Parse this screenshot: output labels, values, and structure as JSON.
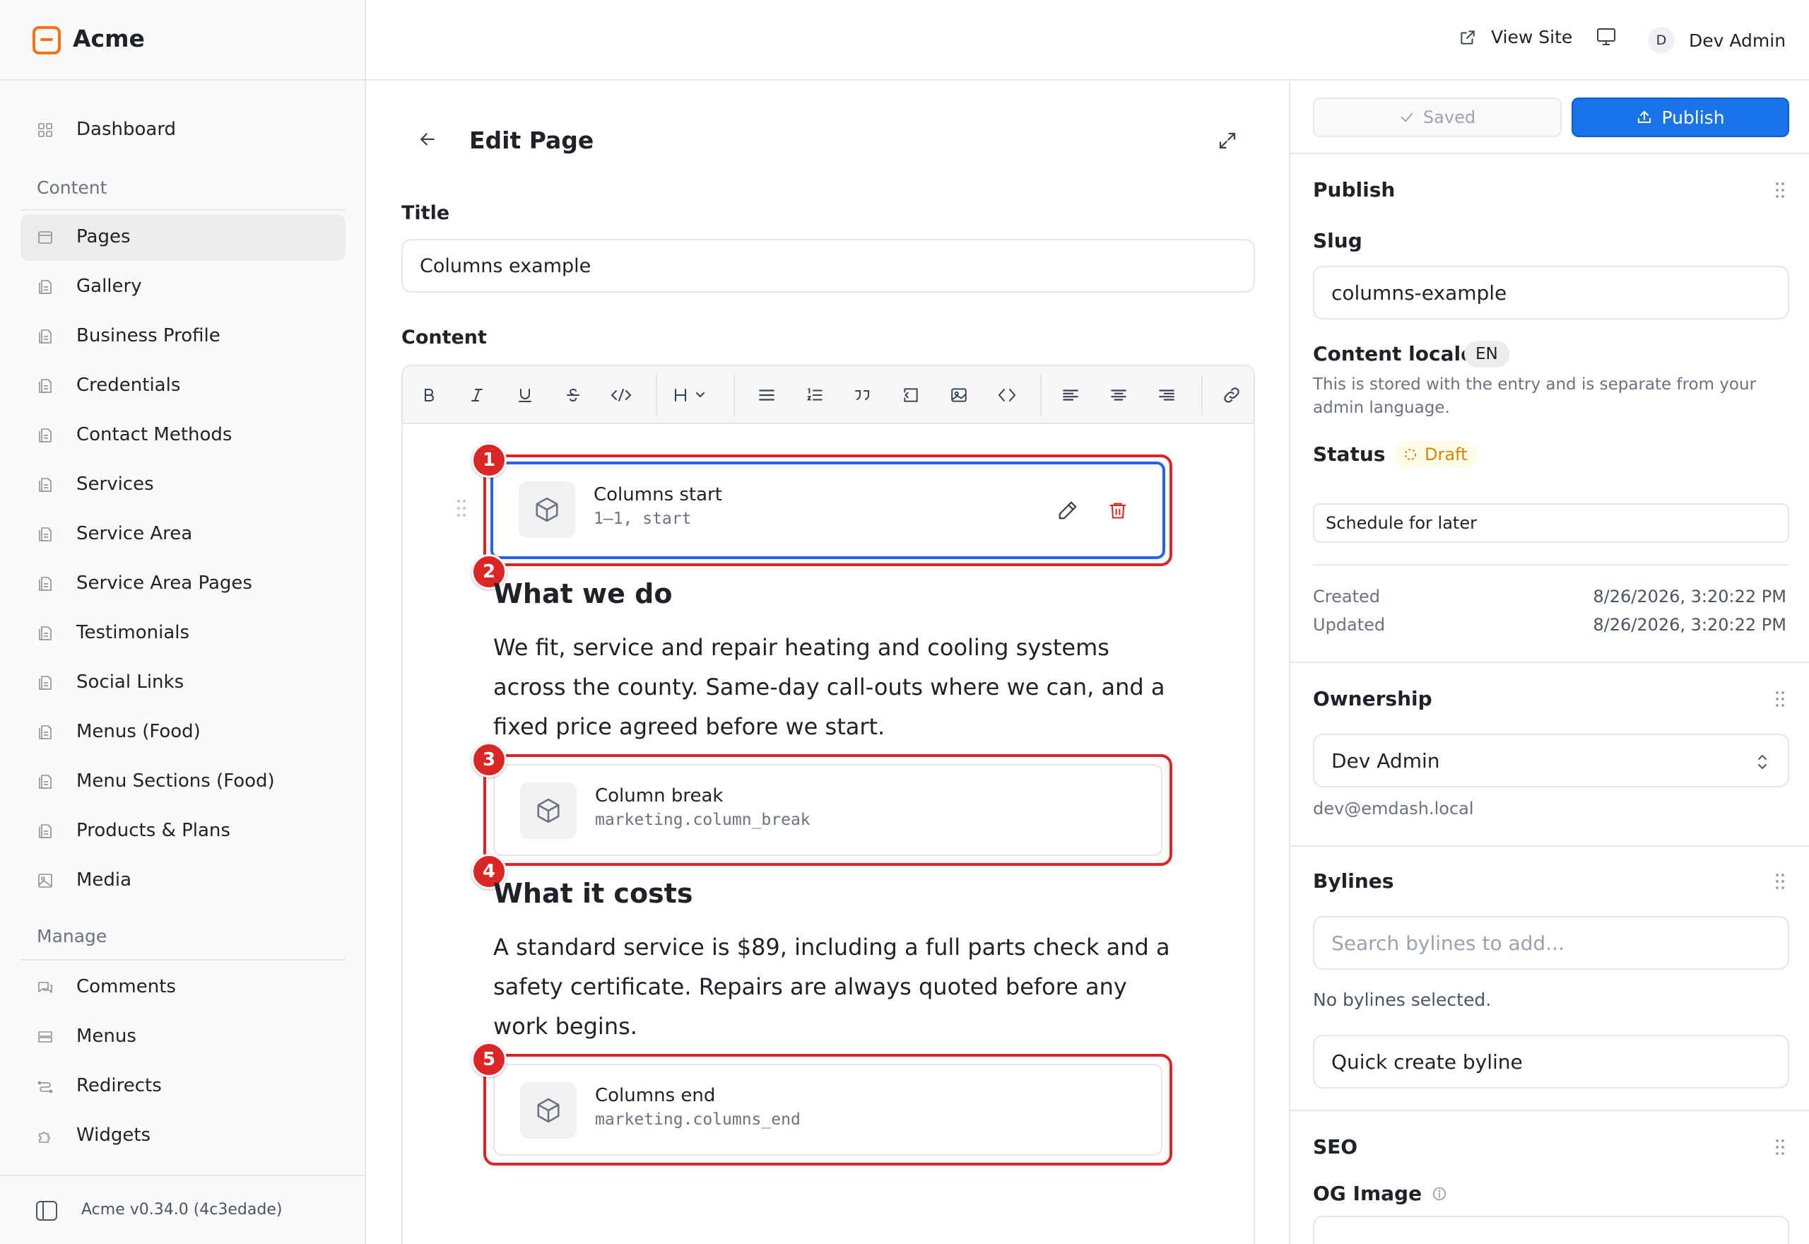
{
  "app": {
    "name": "Acme",
    "version": "Acme v0.34.0 (4c3edade)"
  },
  "topbar": {
    "view_site": "View Site",
    "user_initial": "D",
    "user_name": "Dev Admin"
  },
  "sidebar": {
    "dashboard": "Dashboard",
    "content_heading": "Content",
    "content_items": [
      {
        "label": "Pages",
        "icon": "pages-icon",
        "active": true
      },
      {
        "label": "Gallery",
        "icon": "collection-icon"
      },
      {
        "label": "Business Profile",
        "icon": "collection-icon"
      },
      {
        "label": "Credentials",
        "icon": "collection-icon"
      },
      {
        "label": "Contact Methods",
        "icon": "collection-icon"
      },
      {
        "label": "Services",
        "icon": "collection-icon"
      },
      {
        "label": "Service Area",
        "icon": "collection-icon"
      },
      {
        "label": "Service Area Pages",
        "icon": "collection-icon"
      },
      {
        "label": "Testimonials",
        "icon": "collection-icon"
      },
      {
        "label": "Social Links",
        "icon": "collection-icon"
      },
      {
        "label": "Menus (Food)",
        "icon": "collection-icon"
      },
      {
        "label": "Menu Sections (Food)",
        "icon": "collection-icon"
      },
      {
        "label": "Products & Plans",
        "icon": "collection-icon"
      },
      {
        "label": "Media",
        "icon": "image-icon"
      }
    ],
    "manage_heading": "Manage",
    "manage_items": [
      {
        "label": "Comments",
        "icon": "comments-icon"
      },
      {
        "label": "Menus",
        "icon": "menus-icon"
      },
      {
        "label": "Redirects",
        "icon": "redirects-icon"
      },
      {
        "label": "Widgets",
        "icon": "widgets-icon"
      }
    ]
  },
  "editor": {
    "heading": "Edit Page",
    "title_label": "Title",
    "title_value": "Columns example",
    "content_label": "Content",
    "blocks": [
      {
        "marker": "1",
        "title": "Columns start",
        "subtitle": "1–1, start"
      },
      {
        "marker": "3",
        "title": "Column break",
        "subtitle": "marketing.column_break"
      },
      {
        "marker": "5",
        "title": "Columns end",
        "subtitle": "marketing.columns_end"
      }
    ],
    "markers": {
      "two": "2",
      "four": "4"
    },
    "heading1": "What we do",
    "para1": "We fit, service and repair heating and cooling systems across the county. Same-day call-outs where we can, and a fixed price agreed before we start.",
    "heading2": "What it costs",
    "para2": "A standard service is $89, including a full parts check and a safety certificate. Repairs are always quoted before any work begins."
  },
  "panel": {
    "saved_label": "Saved",
    "publish_button": "Publish",
    "publish_heading": "Publish",
    "slug_label": "Slug",
    "slug_value": "columns-example",
    "locale_label": "Content locale",
    "locale_value": "EN",
    "locale_help": "This is stored with the entry and is separate from your admin language.",
    "status_label": "Status",
    "status_value": "Draft",
    "schedule_label": "Schedule for later",
    "created_label": "Created",
    "created_value": "8/26/2026, 3:20:22 PM",
    "updated_label": "Updated",
    "updated_value": "8/26/2026, 3:20:22 PM",
    "ownership_heading": "Ownership",
    "owner_value": "Dev Admin",
    "owner_email": "dev@emdash.local",
    "bylines_heading": "Bylines",
    "bylines_placeholder": "Search bylines to add...",
    "bylines_empty": "No bylines selected.",
    "quick_create": "Quick create byline",
    "seo_heading": "SEO",
    "og_image_label": "OG Image"
  },
  "colors": {
    "accent": "#1a73e8",
    "marker": "#dc2626",
    "draft": "#ca8a04",
    "brand": "#f97316"
  }
}
